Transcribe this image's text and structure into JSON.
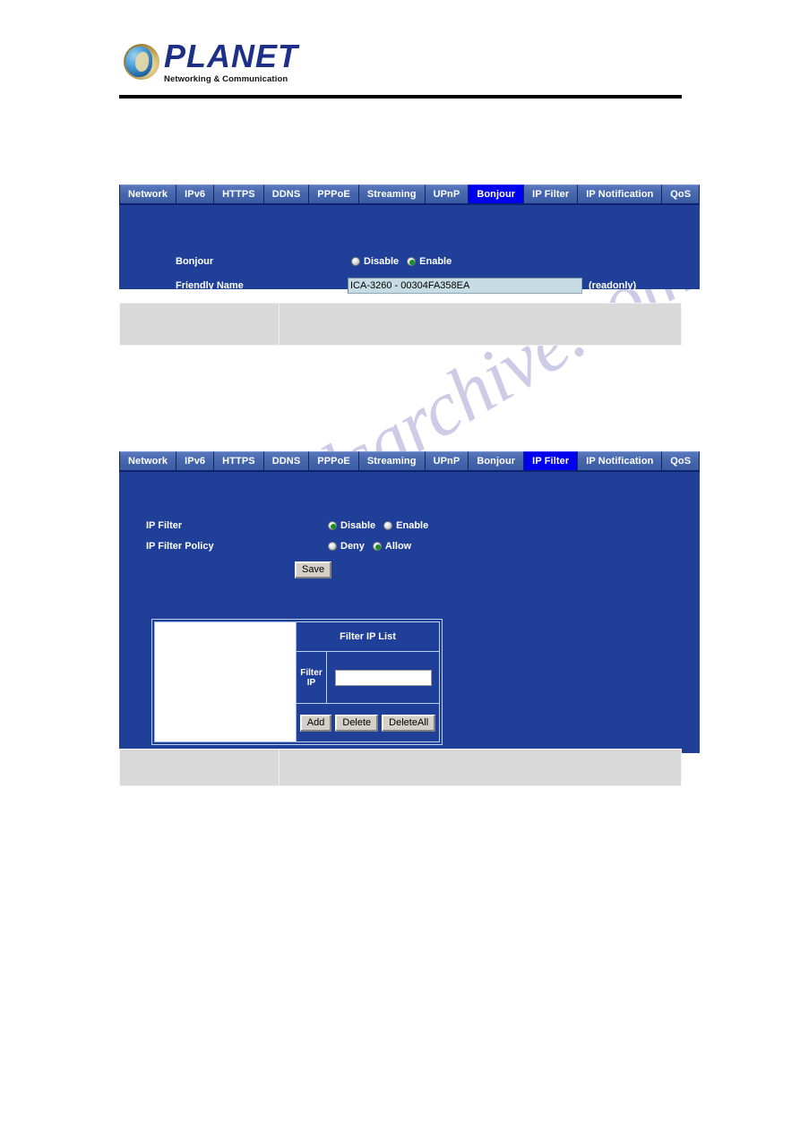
{
  "brand": {
    "name": "PLANET",
    "tagline": "Networking & Communication",
    "logo_icon": "globe-icon"
  },
  "colors": {
    "panel_bg": "#1f3f99",
    "tab_inactive": "#4767ad",
    "tab_active": "#0000ee",
    "tab_text": "#ffffff",
    "input_bg": "#c6dbe4",
    "button_face": "#d4d0c8",
    "radio_selected_dot": "#1a8f28",
    "note_table_bg": "#d9d9d9",
    "rule": "#000000",
    "watermark": "#b9b9de"
  },
  "watermark": {
    "text": "manualsarchive.com"
  },
  "tabs": [
    "Network",
    "IPv6",
    "HTTPS",
    "DDNS",
    "PPPoE",
    "Streaming",
    "UPnP",
    "Bonjour",
    "IP Filter",
    "IP Notification",
    "QoS"
  ],
  "bonjour_panel": {
    "active_tab": "Bonjour",
    "fields": {
      "bonjour_label": "Bonjour",
      "bonjour_options": [
        "Disable",
        "Enable"
      ],
      "bonjour_selected": "Enable",
      "friendly_name_label": "Friendly Name",
      "friendly_name_value": "ICA-3260 - 00304FA358EA",
      "friendly_name_note": "(readonly)"
    }
  },
  "ipfilter_panel": {
    "active_tab": "IP Filter",
    "fields": {
      "ip_filter_label": "IP Filter",
      "ip_filter_options": [
        "Disable",
        "Enable"
      ],
      "ip_filter_selected": "Disable",
      "ip_filter_policy_label": "IP Filter Policy",
      "ip_filter_policy_options": [
        "Deny",
        "Allow"
      ],
      "ip_filter_policy_selected": "Allow",
      "save_label": "Save"
    },
    "filter_list": {
      "header": "Filter IP List",
      "filter_ip_label": "Filter IP",
      "filter_ip_value": "",
      "entries": [],
      "buttons": [
        "Add",
        "Delete",
        "DeleteAll"
      ]
    }
  },
  "note_tables": [
    {
      "left": "",
      "right": ""
    },
    {
      "left": "",
      "right": ""
    }
  ]
}
